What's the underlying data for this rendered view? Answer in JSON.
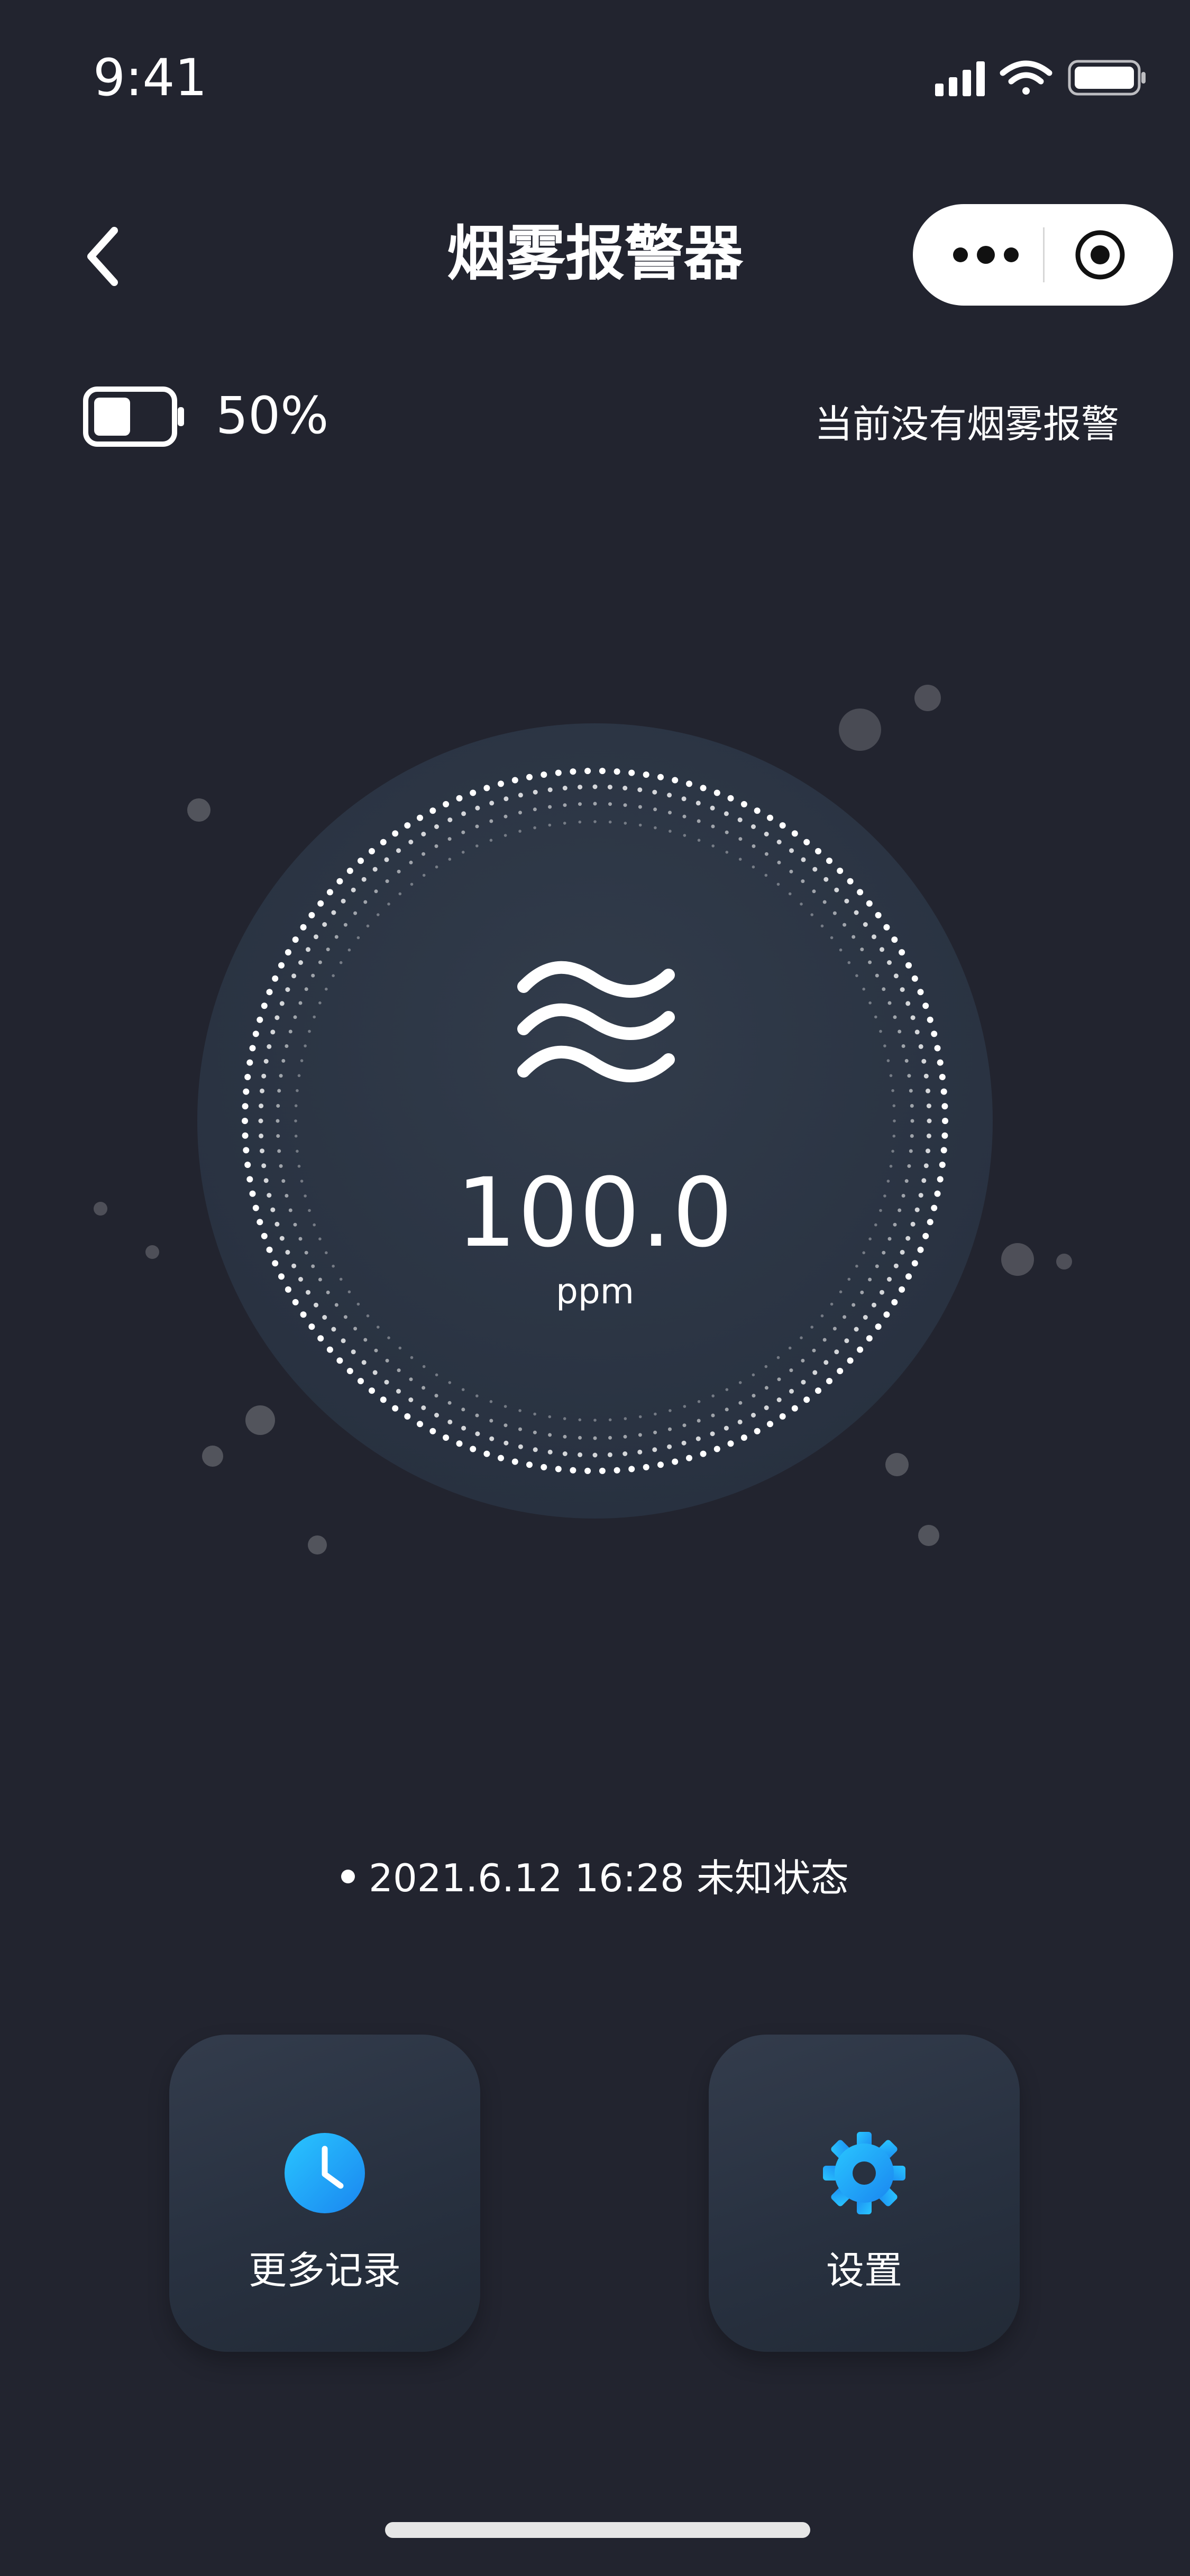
{
  "status_bar": {
    "time": "9:41"
  },
  "nav": {
    "title": "烟雾报警器",
    "back_icon": "chevron-left-icon",
    "capsule_icons": [
      "more-dots-icon",
      "target-circle-icon"
    ]
  },
  "battery": {
    "level_text": "50%",
    "level_fraction": 0.5,
    "icon": "battery-icon"
  },
  "alarm_status": "当前没有烟雾报警",
  "reading": {
    "icon": "smoke-waves-icon",
    "value": "100.0",
    "unit": "ppm"
  },
  "last_update": {
    "datetime": "2021.6.12 16:28",
    "state": "未知状态"
  },
  "actions": {
    "history": {
      "label": "更多记录",
      "icon": "clock-icon",
      "color": "#1e9bf0"
    },
    "settings": {
      "label": "设置",
      "icon": "gear-icon",
      "color": "#1e9bf0"
    }
  },
  "colors": {
    "background": "#22242f",
    "gauge_disc": "#2b3442",
    "accent": "#1e9bf0"
  }
}
